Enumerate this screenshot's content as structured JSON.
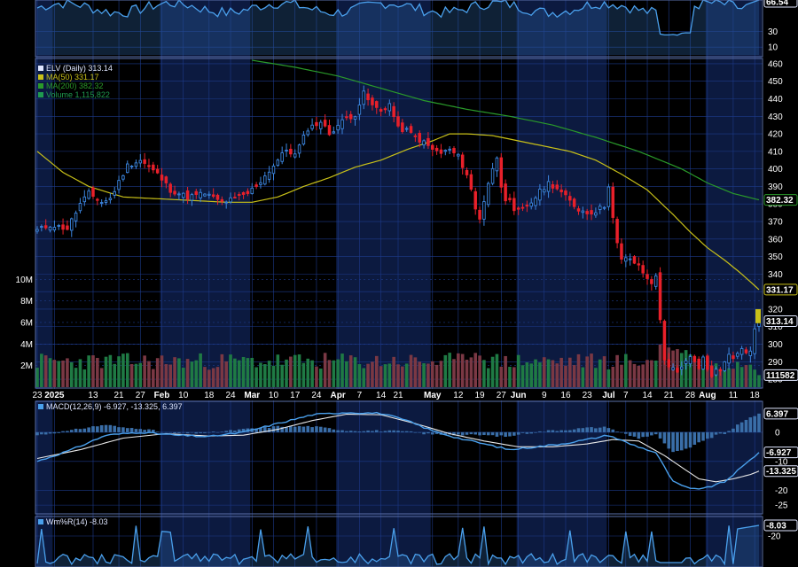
{
  "colors": {
    "background": "#000000",
    "grid": "#1d3a8a",
    "band": "#0c1a40",
    "up": "#3c86e0",
    "down": "#e8202a",
    "ma50": "#c8c018",
    "ma200": "#2a9a2a",
    "vol_up": "#1f7a44",
    "vol_down": "#7a3844",
    "macd_line": "#4aa0ec",
    "signal_line": "#e8e8e8",
    "hist": "#3a6ea8",
    "willr": "#4aa0ec"
  },
  "chart_data": [
    {
      "type": "candlestick",
      "panel": "price",
      "legend": [
        {
          "text": "ELV (Daily) 313.14",
          "color": "#dfe6ff"
        },
        {
          "text": "MA(50) 331.17",
          "color": "#c8c018"
        },
        {
          "text": "MA(200) 382.32",
          "color": "#2a9a2a"
        },
        {
          "text": "Volume 1,115,822",
          "color": "#1f9a50"
        }
      ],
      "y_ticks": [
        460,
        450,
        440,
        430,
        420,
        410,
        400,
        390,
        380,
        370,
        360,
        350,
        340,
        330,
        320,
        310,
        300,
        290,
        280
      ],
      "y_range": [
        275,
        463
      ],
      "price_tags": [
        {
          "label": "382.32",
          "value": 382.32,
          "kind": "ma200"
        },
        {
          "label": "331.17",
          "value": 331.17,
          "kind": "ma50"
        },
        {
          "label": "313.14",
          "value": 313.14,
          "kind": "last"
        }
      ],
      "x_labels": [
        {
          "label": "23",
          "i": 0
        },
        {
          "label": "2025",
          "i": 4,
          "bold": true
        },
        {
          "label": "13",
          "i": 13
        },
        {
          "label": "21",
          "i": 19
        },
        {
          "label": "27",
          "i": 24
        },
        {
          "label": "Feb",
          "i": 29,
          "bold": true
        },
        {
          "label": "10",
          "i": 34
        },
        {
          "label": "18",
          "i": 40
        },
        {
          "label": "24",
          "i": 45
        },
        {
          "label": "Mar",
          "i": 50,
          "bold": true
        },
        {
          "label": "10",
          "i": 55
        },
        {
          "label": "17",
          "i": 60
        },
        {
          "label": "24",
          "i": 65
        },
        {
          "label": "Apr",
          "i": 70,
          "bold": true
        },
        {
          "label": "7",
          "i": 75
        },
        {
          "label": "14",
          "i": 80
        },
        {
          "label": "21",
          "i": 84
        },
        {
          "label": "May",
          "i": 92,
          "bold": true
        },
        {
          "label": "12",
          "i": 98
        },
        {
          "label": "19",
          "i": 103
        },
        {
          "label": "27",
          "i": 108
        },
        {
          "label": "Jun",
          "i": 112,
          "bold": true
        },
        {
          "label": "9",
          "i": 118
        },
        {
          "label": "16",
          "i": 123
        },
        {
          "label": "23",
          "i": 128
        },
        {
          "label": "Jul",
          "i": 133,
          "bold": true
        },
        {
          "label": "7",
          "i": 137
        },
        {
          "label": "14",
          "i": 142
        },
        {
          "label": "21",
          "i": 147
        },
        {
          "label": "28",
          "i": 152
        },
        {
          "label": "Aug",
          "i": 156,
          "bold": true
        },
        {
          "label": "11",
          "i": 162
        },
        {
          "label": "18",
          "i": 167
        }
      ],
      "price_keyframes": [
        [
          0,
          365
        ],
        [
          3,
          368
        ],
        [
          7,
          366
        ],
        [
          10,
          380
        ],
        [
          12,
          386
        ],
        [
          15,
          381
        ],
        [
          17,
          383
        ],
        [
          21,
          402
        ],
        [
          24,
          405
        ],
        [
          28,
          397
        ],
        [
          31,
          388
        ],
        [
          35,
          384
        ],
        [
          39,
          386
        ],
        [
          43,
          381
        ],
        [
          46,
          383
        ],
        [
          49,
          386
        ],
        [
          52,
          393
        ],
        [
          56,
          405
        ],
        [
          58,
          411
        ],
        [
          60,
          408
        ],
        [
          63,
          423
        ],
        [
          66,
          427
        ],
        [
          68,
          420
        ],
        [
          70,
          425
        ],
        [
          72,
          429
        ],
        [
          74,
          431
        ],
        [
          76,
          443
        ],
        [
          78,
          436
        ],
        [
          80,
          433
        ],
        [
          82,
          437
        ],
        [
          84,
          423
        ],
        [
          86,
          422
        ],
        [
          88,
          418
        ],
        [
          90,
          415
        ],
        [
          92,
          411
        ],
        [
          94,
          409
        ],
        [
          96,
          411
        ],
        [
          98,
          407
        ],
        [
          100,
          397
        ],
        [
          101,
          388
        ],
        [
          102,
          377
        ],
        [
          103,
          372
        ],
        [
          105,
          392
        ],
        [
          107,
          407
        ],
        [
          108,
          391
        ],
        [
          109,
          383
        ],
        [
          110,
          381
        ],
        [
          111,
          375
        ],
        [
          113,
          377
        ],
        [
          115,
          381
        ],
        [
          117,
          387
        ],
        [
          119,
          392
        ],
        [
          121,
          389
        ],
        [
          123,
          384
        ],
        [
          125,
          379
        ],
        [
          126,
          377
        ],
        [
          128,
          375
        ],
        [
          130,
          376
        ],
        [
          132,
          379
        ],
        [
          133,
          391
        ],
        [
          134,
          372
        ],
        [
          135,
          357
        ],
        [
          136,
          348
        ],
        [
          138,
          349
        ],
        [
          140,
          344
        ],
        [
          141,
          341
        ],
        [
          142,
          337
        ],
        [
          143,
          335
        ],
        [
          144,
          340
        ],
        [
          145,
          313
        ],
        [
          146,
          291
        ],
        [
          147,
          288
        ],
        [
          148,
          287
        ],
        [
          149,
          283
        ],
        [
          150,
          286
        ],
        [
          151,
          290
        ],
        [
          152,
          292
        ],
        [
          153,
          290
        ],
        [
          154,
          287
        ],
        [
          155,
          292
        ],
        [
          156,
          285
        ],
        [
          157,
          282
        ],
        [
          158,
          287
        ],
        [
          159,
          284
        ],
        [
          160,
          290
        ],
        [
          161,
          295
        ],
        [
          162,
          293
        ],
        [
          163,
          296
        ],
        [
          164,
          297
        ],
        [
          165,
          296
        ],
        [
          166,
          296
        ],
        [
          167,
          308
        ],
        [
          168,
          313.14
        ]
      ],
      "ma50_keyframes": [
        [
          0,
          410
        ],
        [
          6,
          398
        ],
        [
          12,
          390
        ],
        [
          20,
          384
        ],
        [
          28,
          383
        ],
        [
          36,
          382
        ],
        [
          44,
          381
        ],
        [
          50,
          381
        ],
        [
          56,
          384
        ],
        [
          62,
          390
        ],
        [
          68,
          395
        ],
        [
          74,
          401
        ],
        [
          80,
          405
        ],
        [
          86,
          411
        ],
        [
          92,
          416
        ],
        [
          96,
          420
        ],
        [
          100,
          420
        ],
        [
          106,
          419
        ],
        [
          112,
          416
        ],
        [
          118,
          413
        ],
        [
          124,
          410
        ],
        [
          130,
          405
        ],
        [
          136,
          397
        ],
        [
          142,
          388
        ],
        [
          148,
          374
        ],
        [
          152,
          364
        ],
        [
          156,
          355
        ],
        [
          160,
          348
        ],
        [
          164,
          340
        ],
        [
          168,
          331.17
        ]
      ],
      "ma200_keyframes": [
        [
          50,
          462
        ],
        [
          60,
          458
        ],
        [
          70,
          453
        ],
        [
          80,
          446
        ],
        [
          90,
          439
        ],
        [
          100,
          434
        ],
        [
          110,
          430
        ],
        [
          120,
          425
        ],
        [
          130,
          418
        ],
        [
          140,
          410
        ],
        [
          150,
          400
        ],
        [
          156,
          392
        ],
        [
          162,
          386
        ],
        [
          168,
          382.32
        ]
      ],
      "volume_axis": {
        "ticks": [
          {
            "label": "10M",
            "value": 10000000
          },
          {
            "label": "8M",
            "value": 8000000
          },
          {
            "label": "6M",
            "value": 6000000
          },
          {
            "label": "4M",
            "value": 4000000
          },
          {
            "label": "2M",
            "value": 2000000
          }
        ],
        "max": 10600000,
        "last_tag": "111582",
        "last_value": 1115822
      }
    },
    {
      "type": "line",
      "panel": "rsi_top",
      "y_ticks": [
        30,
        10
      ],
      "tag": "66.54",
      "y_range": [
        0,
        70
      ]
    },
    {
      "type": "macd",
      "panel": "macd",
      "legend": "MACD(12,26,9) -6.927, -13.325, 6.397",
      "y_ticks": [
        {
          "label": "0",
          "value": 0
        },
        {
          "label": "-10",
          "value": -10
        },
        {
          "label": "-20",
          "value": -20
        },
        {
          "label": "-25",
          "value": -25
        }
      ],
      "y_range": [
        -28,
        10
      ],
      "tags": [
        {
          "label": "6.397",
          "value": 6.397,
          "kind": "hist"
        },
        {
          "label": "-6.927",
          "value": -6.927,
          "kind": "macd"
        },
        {
          "label": "-13.325",
          "value": -13.325,
          "kind": "signal"
        }
      ],
      "macd_keyframes": [
        [
          0,
          -10
        ],
        [
          8,
          -6
        ],
        [
          16,
          -1
        ],
        [
          24,
          0
        ],
        [
          32,
          -1
        ],
        [
          40,
          -1.5
        ],
        [
          48,
          0
        ],
        [
          56,
          3
        ],
        [
          64,
          6
        ],
        [
          72,
          6.8
        ],
        [
          80,
          6.5
        ],
        [
          86,
          4
        ],
        [
          92,
          0.5
        ],
        [
          98,
          -2
        ],
        [
          104,
          -4
        ],
        [
          110,
          -6
        ],
        [
          116,
          -5
        ],
        [
          122,
          -4
        ],
        [
          128,
          -2.5
        ],
        [
          133,
          -1
        ],
        [
          138,
          -4
        ],
        [
          144,
          -7
        ],
        [
          148,
          -17
        ],
        [
          152,
          -19.5
        ],
        [
          156,
          -19
        ],
        [
          160,
          -17
        ],
        [
          164,
          -12
        ],
        [
          168,
          -6.927
        ]
      ],
      "signal_keyframes": [
        [
          0,
          -9
        ],
        [
          10,
          -6
        ],
        [
          20,
          -2
        ],
        [
          30,
          -0.5
        ],
        [
          40,
          -1.3
        ],
        [
          48,
          -1
        ],
        [
          56,
          1
        ],
        [
          64,
          4
        ],
        [
          72,
          6.2
        ],
        [
          80,
          6
        ],
        [
          88,
          3
        ],
        [
          96,
          -0.5
        ],
        [
          104,
          -3
        ],
        [
          112,
          -5
        ],
        [
          120,
          -5
        ],
        [
          128,
          -4
        ],
        [
          134,
          -2.5
        ],
        [
          140,
          -3
        ],
        [
          146,
          -8
        ],
        [
          150,
          -12
        ],
        [
          154,
          -16
        ],
        [
          158,
          -17
        ],
        [
          162,
          -16
        ],
        [
          166,
          -14.5
        ],
        [
          168,
          -13.325
        ]
      ]
    },
    {
      "type": "line",
      "panel": "williams",
      "legend": "Wm%R(14) -8.03",
      "y_ticks": [
        {
          "label": "-20",
          "value": -20
        }
      ],
      "y_range": [
        -55,
        0
      ],
      "tag": "-8.03",
      "tag_value": -8.03
    }
  ]
}
